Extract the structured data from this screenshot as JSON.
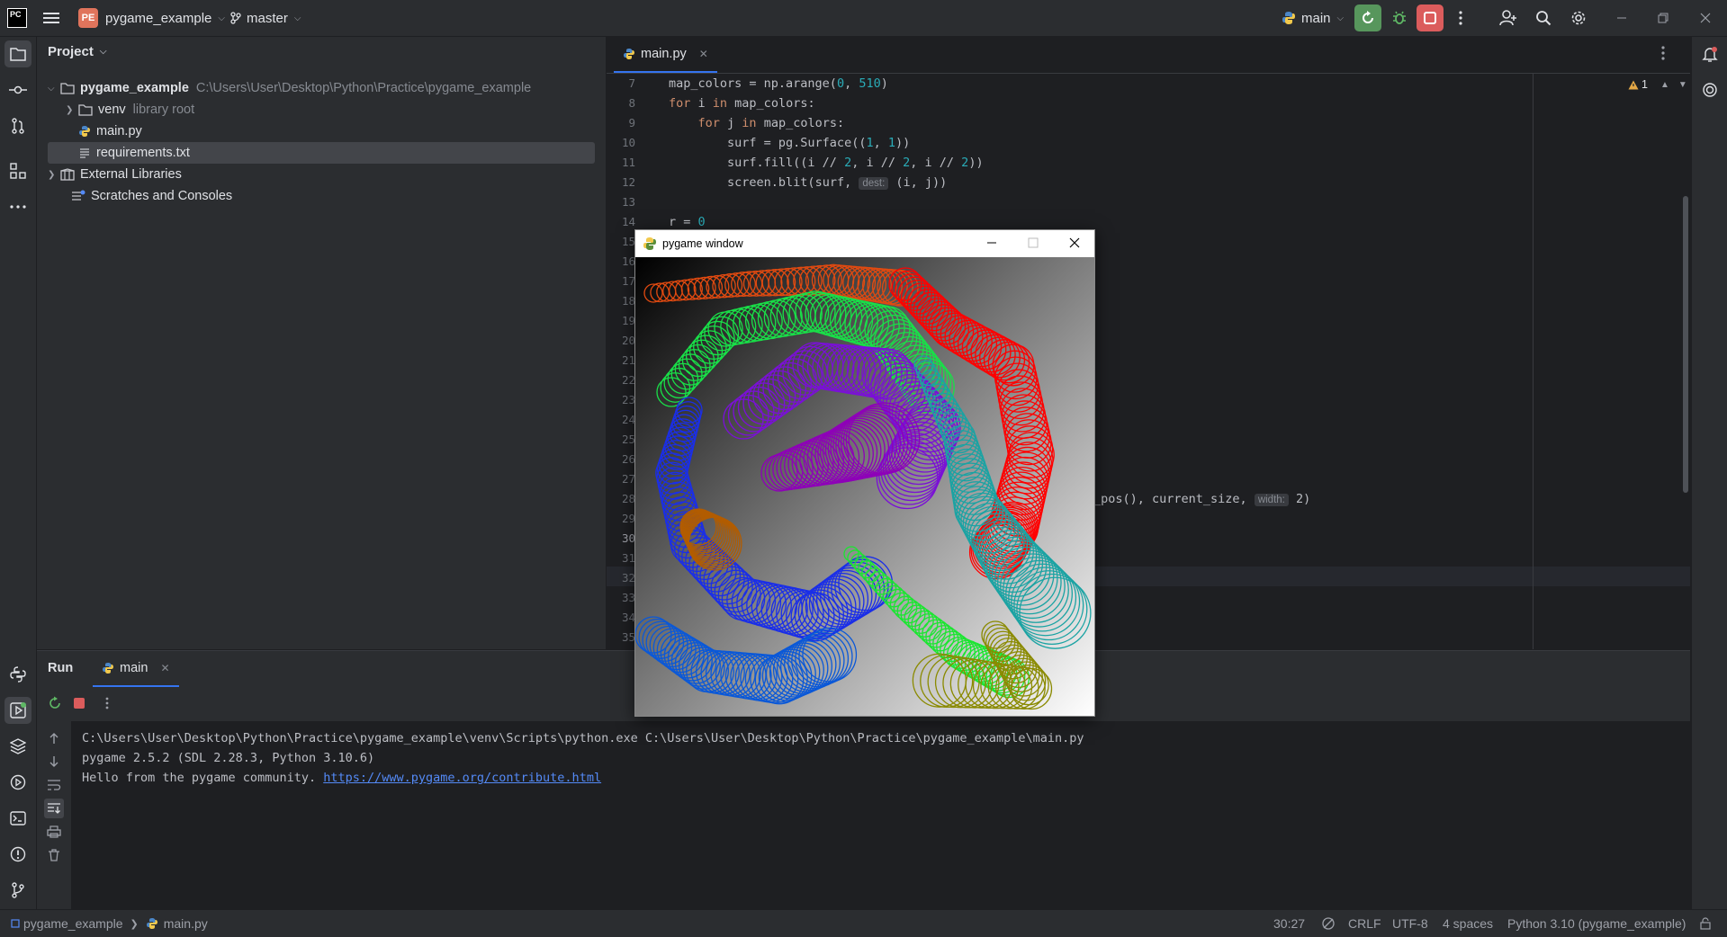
{
  "titlebar": {
    "project_initials": "PE",
    "project_name": "pygame_example",
    "branch": "master",
    "run_config": "main"
  },
  "project_panel": {
    "title": "Project",
    "tree": [
      {
        "label": "pygame_example",
        "hint": "C:\\Users\\User\\Desktop\\Python\\Practice\\pygame_example"
      },
      {
        "label": "venv",
        "hint": "library root"
      },
      {
        "label": "main.py"
      },
      {
        "label": "requirements.txt",
        "selected": true
      },
      {
        "label": "External Libraries"
      },
      {
        "label": "Scratches and Consoles"
      }
    ]
  },
  "editor": {
    "tab": "main.py",
    "warning_count": "1",
    "line_numbers": [
      "7",
      "8",
      "9",
      "10",
      "11",
      "12",
      "13",
      "14",
      "15",
      "16",
      "17",
      "18",
      "19",
      "20",
      "21",
      "22",
      "23",
      "24",
      "25",
      "26",
      "27",
      "28",
      "29",
      "30",
      "31",
      "32",
      "33",
      "34",
      "35"
    ],
    "current_line": "30",
    "code": {
      "l7": "map_colors = np.arange(0, 510)",
      "l8": "for i in map_colors:",
      "l9": "for j in map_colors:",
      "l10": "surf = pg.Surface((1, 1))",
      "l11": "surf.fill((i // 2, i // 2, i // 2))",
      "l12_a": "screen.blit(surf, ",
      "l12_hint": "dest:",
      "l12_b": " (i, j))",
      "l14": "r = 0",
      "l28_a": "_pos(), current_size, ",
      "l28_hint": "width:",
      "l28_b": " 2)"
    }
  },
  "pygame_window": {
    "title": "pygame window"
  },
  "run_panel": {
    "title": "Run",
    "tab": "main",
    "console": [
      "C:\\Users\\User\\Desktop\\Python\\Practice\\pygame_example\\venv\\Scripts\\python.exe C:\\Users\\User\\Desktop\\Python\\Practice\\pygame_example\\main.py",
      "pygame 2.5.2 (SDL 2.28.3, Python 3.10.6)"
    ],
    "hello_text": "Hello from the pygame community. ",
    "hello_link": "https://www.pygame.org/contribute.html"
  },
  "statusbar": {
    "crumb_project": "pygame_example",
    "crumb_file": "main.py",
    "position": "30:27",
    "line_sep": "CRLF",
    "encoding": "UTF-8",
    "indent": "4 spaces",
    "interpreter": "Python 3.10 (pygame_example)"
  },
  "colors": {
    "accent": "#3574f0",
    "run_green": "#57965c",
    "stop_red": "#db5c5c"
  }
}
